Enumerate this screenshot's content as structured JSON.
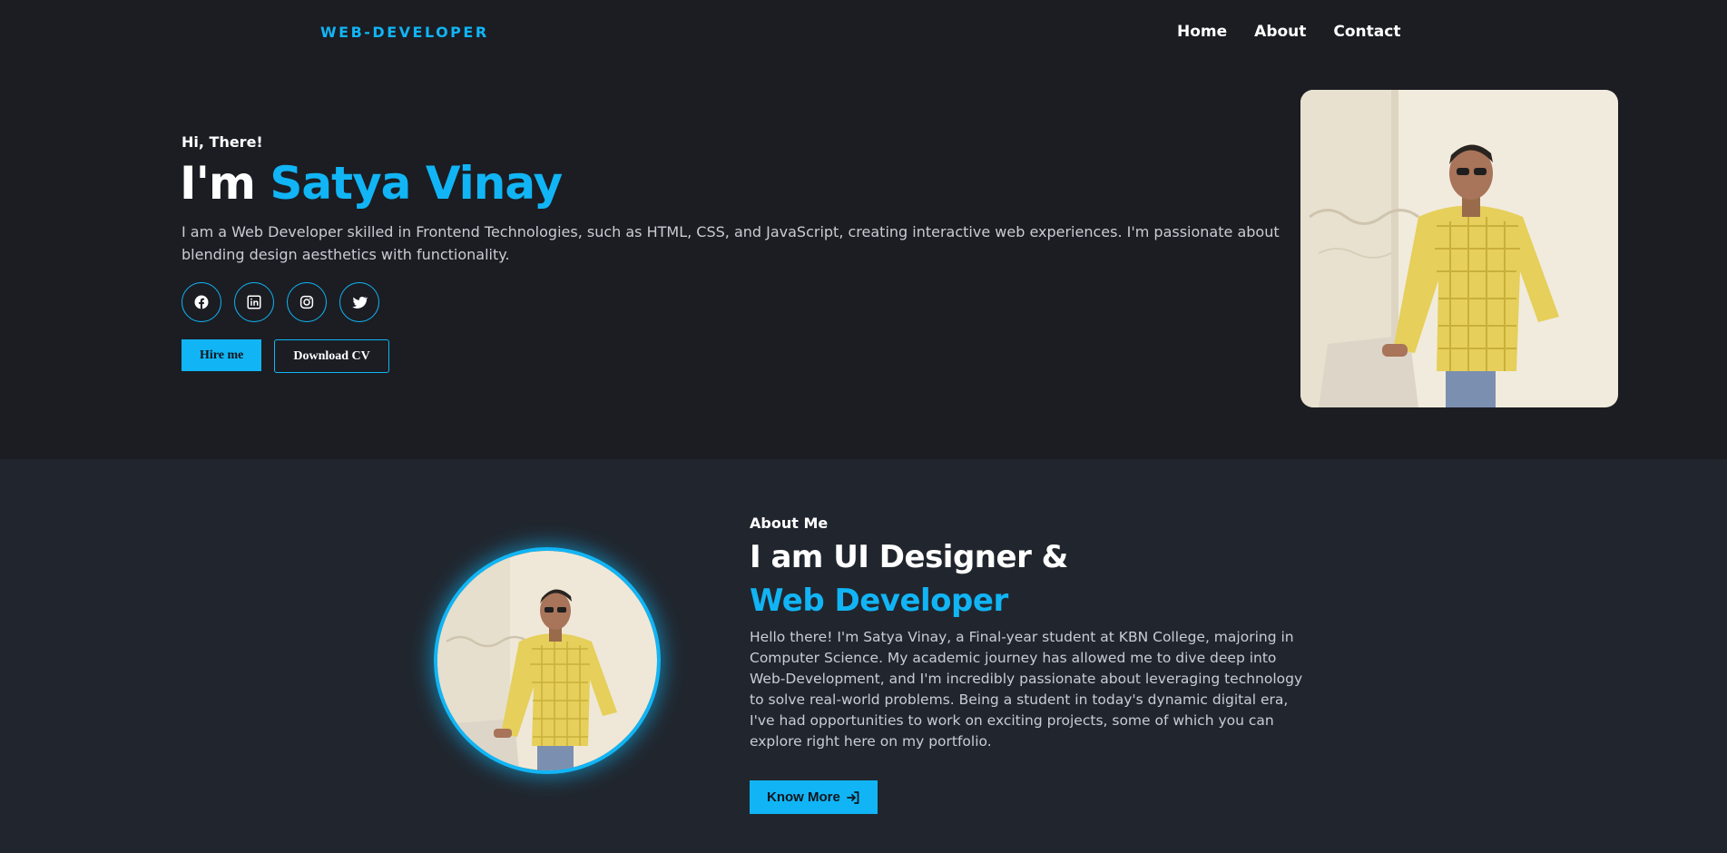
{
  "nav": {
    "logo": "WEB-DEVELOPER",
    "links": [
      "Home",
      "About",
      "Contact"
    ]
  },
  "hero": {
    "greeting": "Hi, There!",
    "title_prefix": "I'm ",
    "name": "Satya Vinay",
    "description": "I am a Web Developer skilled in Frontend Technologies, such as HTML, CSS, and JavaScript, creating interactive web experiences. I'm passionate about blending design aesthetics with functionality.",
    "socials": [
      "facebook-icon",
      "linkedin-icon",
      "instagram-icon",
      "twitter-icon"
    ],
    "hire_label": "Hire me",
    "cv_label": "Download CV"
  },
  "about": {
    "label": "About Me",
    "title_line1": "I am UI Designer &",
    "title_line2": "Web Developer",
    "description": "Hello there! I'm Satya Vinay, a Final-year student at KBN College, majoring in Computer Science. My academic journey has allowed me to dive deep into Web-Development, and I'm incredibly passionate about leveraging technology to solve real-world problems. Being a student in today's dynamic digital era, I've had opportunities to work on exciting projects, some of which you can explore right here on my portfolio.",
    "button_label": "Know More",
    "button_icon": "arrow-right-to-bracket-icon"
  },
  "colors": {
    "accent": "#11b5f5",
    "hero_bg": "#1b1d23",
    "about_bg": "#21262e",
    "text_muted": "#c9ccd3"
  }
}
